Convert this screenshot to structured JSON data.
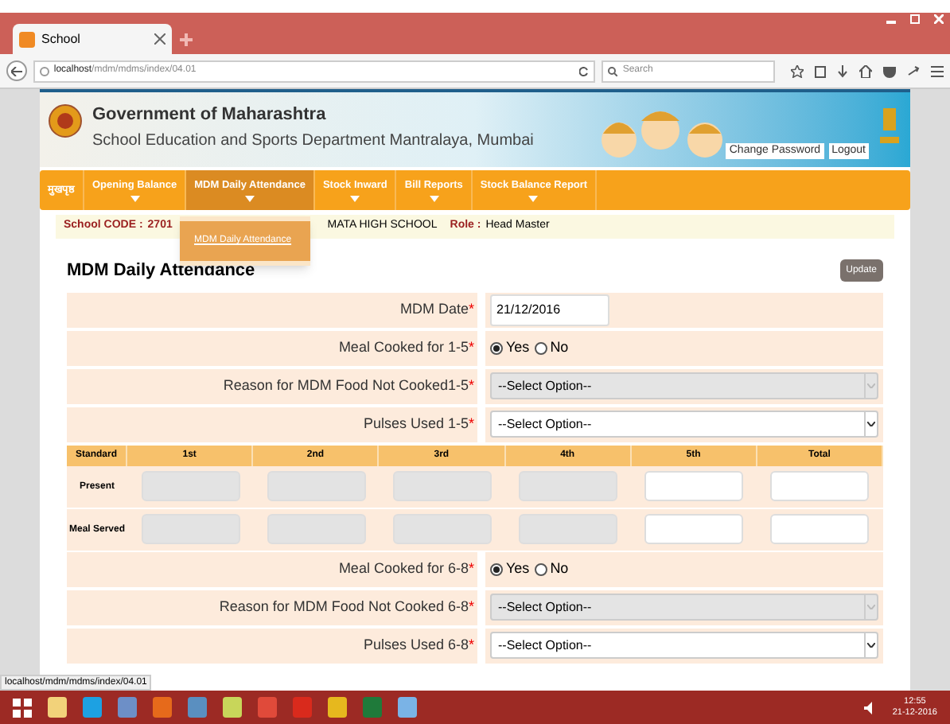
{
  "browser": {
    "tab_title": "School",
    "url_host": "localhost",
    "url_path": "/mdm/mdms/index/04.01",
    "search_placeholder": "Search",
    "status_url": "localhost/mdm/mdms/index/04.01"
  },
  "header": {
    "title": "Government of Maharashtra",
    "subtitle": "School Education and Sports Department Mantralaya, Mumbai",
    "links": [
      "Change Password",
      "Logout"
    ]
  },
  "menu": [
    {
      "label": "मुखपृष्ठ",
      "selected": false,
      "caret": false
    },
    {
      "label": "Opening Balance",
      "selected": false,
      "caret": true
    },
    {
      "label": "MDM Daily Attendance",
      "selected": true,
      "caret": true
    },
    {
      "label": "Stock Inward",
      "selected": false,
      "caret": true
    },
    {
      "label": "Bill Reports",
      "selected": false,
      "caret": true
    },
    {
      "label": "Stock Balance Report",
      "selected": false,
      "caret": true
    }
  ],
  "dropdown": {
    "items": [
      "MDM Daily Attendance"
    ]
  },
  "info": {
    "school_code_label": "School CODE :",
    "school_code": "2701",
    "school_name": "MATA HIGH SCHOOL",
    "role_label": "Role :",
    "role": "Head Master"
  },
  "required_mark": "*",
  "page_title": "MDM Daily Attendance",
  "update_button": "Update",
  "form_top": [
    {
      "kind": "date",
      "label": "MDM Date",
      "value": "21/12/2016"
    },
    {
      "kind": "radio",
      "label": "Meal Cooked for 1-5",
      "options": [
        {
          "label": "Yes",
          "selected": true
        },
        {
          "label": "No",
          "selected": false
        }
      ]
    },
    {
      "kind": "select",
      "label": "Reason for MDM Food Not Cooked1-5",
      "value": "--Select Option--",
      "disabled": true
    },
    {
      "kind": "select",
      "label": "Pulses Used 1-5",
      "value": "--Select Option--",
      "disabled": false
    }
  ],
  "table": {
    "columns": [
      "Standard",
      "1st",
      "2nd",
      "3rd",
      "4th",
      "5th",
      "Total"
    ],
    "rows": [
      {
        "label": "Present",
        "cells": [
          {
            "disabled": true
          },
          {
            "disabled": true
          },
          {
            "disabled": true
          },
          {
            "disabled": true
          },
          {
            "disabled": false
          },
          {
            "disabled": false
          }
        ]
      },
      {
        "label": "Meal Served",
        "cells": [
          {
            "disabled": true
          },
          {
            "disabled": true
          },
          {
            "disabled": true
          },
          {
            "disabled": true
          },
          {
            "disabled": false
          },
          {
            "disabled": false
          }
        ]
      }
    ]
  },
  "form_bottom": [
    {
      "kind": "radio",
      "label": "Meal Cooked for 6-8",
      "options": [
        {
          "label": "Yes",
          "selected": true
        },
        {
          "label": "No",
          "selected": false
        }
      ]
    },
    {
      "kind": "select",
      "label": "Reason for MDM Food Not Cooked 6-8",
      "value": "--Select Option--",
      "disabled": true
    },
    {
      "kind": "select",
      "label": "Pulses Used 6-8",
      "value": "--Select Option--",
      "disabled": false
    }
  ],
  "taskbar": {
    "time": "12:55",
    "date": "21-12-2016"
  }
}
